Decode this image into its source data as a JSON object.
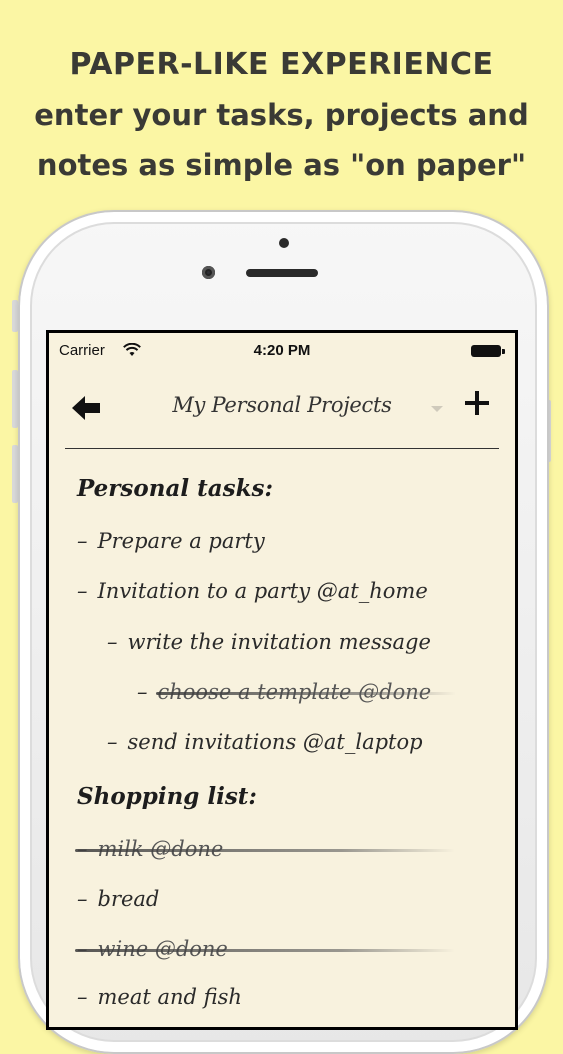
{
  "headline": {
    "line1": "PAPER-LIKE EXPERIENCE",
    "line2": "enter your tasks, projects and",
    "line3": "notes as simple as \"on paper\""
  },
  "status_bar": {
    "carrier": "Carrier",
    "time": "4:20 PM"
  },
  "navbar": {
    "title": "My Personal Projects",
    "back_icon": "back-arrow-icon",
    "add_icon": "plus-icon",
    "dropdown_icon": "chevron-down-icon"
  },
  "sections": [
    {
      "title": "Personal tasks:",
      "items": [
        {
          "text": "Prepare a party",
          "done": false
        },
        {
          "text": "Invitation to a party @at_home",
          "done": false
        },
        {
          "text": "write the invitation message",
          "done": false
        },
        {
          "text": "choose a template @done",
          "done": true
        },
        {
          "text": "send invitations @at_laptop",
          "done": false
        }
      ]
    },
    {
      "title": "Shopping list:",
      "items": [
        {
          "text": "milk @done",
          "done": true
        },
        {
          "text": "bread",
          "done": false
        },
        {
          "text": "wine @done",
          "done": true
        },
        {
          "text": "meat and fish",
          "done": false
        }
      ]
    }
  ],
  "dash": "–",
  "colors": {
    "background": "#fbf6a4",
    "paper": "#f8f2de",
    "text": "#2a2a2a"
  }
}
